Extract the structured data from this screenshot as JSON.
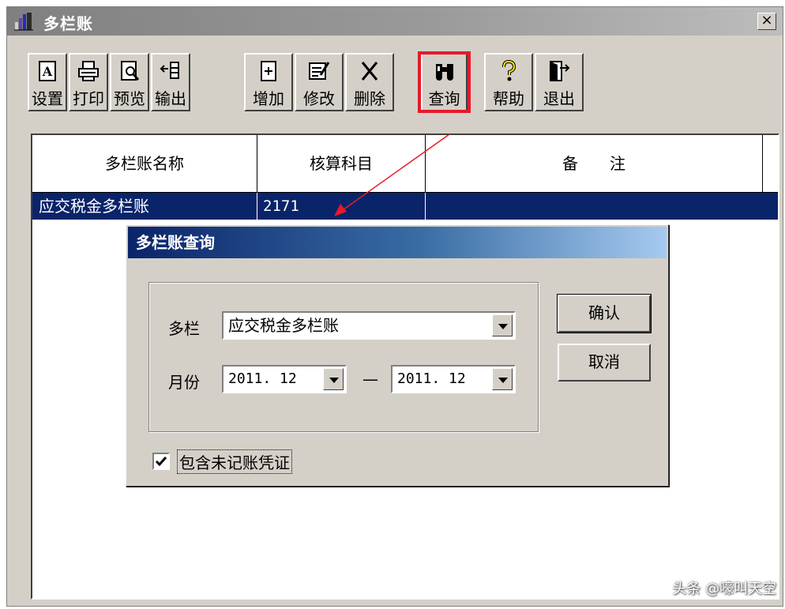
{
  "window": {
    "title": "多栏账",
    "close": "×"
  },
  "toolbar": {
    "items": [
      {
        "label": "设置",
        "icon": "page-setup-icon"
      },
      {
        "label": "打印",
        "icon": "printer-icon"
      },
      {
        "label": "预览",
        "icon": "preview-icon"
      },
      {
        "label": "输出",
        "icon": "export-icon"
      },
      {
        "label": "增加",
        "icon": "add-icon"
      },
      {
        "label": "修改",
        "icon": "edit-icon"
      },
      {
        "label": "删除",
        "icon": "delete-icon"
      },
      {
        "label": "查询",
        "icon": "binoculars-icon"
      },
      {
        "label": "帮助",
        "icon": "help-icon"
      },
      {
        "label": "退出",
        "icon": "exit-icon"
      }
    ],
    "highlight_color": "#e8192a"
  },
  "grid": {
    "columns": [
      "多栏账名称",
      "核算科目",
      "备　　注"
    ],
    "rows": [
      {
        "name": "应交税金多栏账",
        "subject": "2171",
        "note": ""
      }
    ],
    "selection_color": "#0a246a"
  },
  "dialog": {
    "title": "多栏账查询",
    "ledger_label": "多栏",
    "ledger_value": "应交税金多栏账",
    "month_label": "月份",
    "month_from": "2011. 12",
    "month_sep": "—",
    "month_to": "2011. 12",
    "confirm": "确认",
    "cancel": "取消",
    "include_unposted": "包含未记账凭证"
  },
  "watermark": "头条 @嚎叫天空"
}
